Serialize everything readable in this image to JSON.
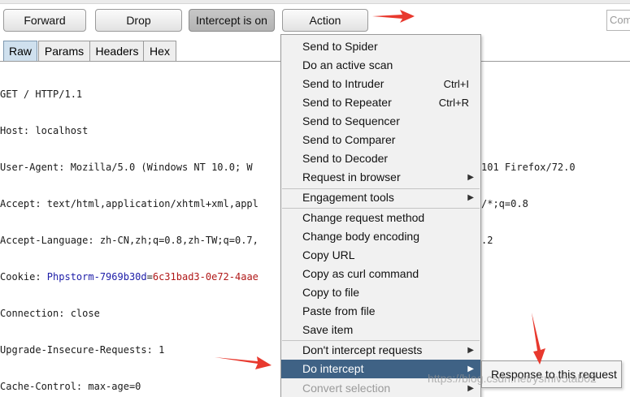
{
  "toolbar": {
    "forward_label": "Forward",
    "drop_label": "Drop",
    "intercept_label": "Intercept is on",
    "action_label": "Action",
    "search_placeholder": "Comment this item"
  },
  "tabs": [
    {
      "label": "Raw",
      "active": true
    },
    {
      "label": "Params",
      "active": false
    },
    {
      "label": "Headers",
      "active": false
    },
    {
      "label": "Hex",
      "active": false
    }
  ],
  "request": {
    "l1": "GET / HTTP/1.1",
    "l2": "Host: localhost",
    "l3a": "User-Agent: Mozilla/5.0 (Windows NT 10.0; W",
    "l3b": "101 Firefox/72.0",
    "l4a": "Accept: text/html,application/xhtml+xml,appl",
    "l4b": "/*;q=0.8",
    "l5a": "Accept-Language: zh-CN,zh;q=0.8,zh-TW;q=0.7,",
    "l5b": ".2",
    "l6_key": "Cookie: ",
    "l6_name": "Phpstorm-7969b30d",
    "l6_eq": "=",
    "l6_value": "6c31bad3-0e72-4aae",
    "l7": "Connection: close",
    "l8": "Upgrade-Insecure-Requests: 1",
    "l9": "Cache-Control: max-age=0"
  },
  "menu": {
    "items": [
      {
        "label": "Send to Spider"
      },
      {
        "label": "Do an active scan"
      },
      {
        "label": "Send to Intruder",
        "shortcut": "Ctrl+I"
      },
      {
        "label": "Send to Repeater",
        "shortcut": "Ctrl+R"
      },
      {
        "label": "Send to Sequencer"
      },
      {
        "label": "Send to Comparer"
      },
      {
        "label": "Send to Decoder"
      },
      {
        "label": "Request in browser",
        "arrow": "▶"
      },
      {
        "label": "Engagement tools",
        "arrow": "▶"
      },
      {
        "label": "Change request method"
      },
      {
        "label": "Change body encoding"
      },
      {
        "label": "Copy URL"
      },
      {
        "label": "Copy as curl command"
      },
      {
        "label": "Copy to file"
      },
      {
        "label": "Paste from file"
      },
      {
        "label": "Save item"
      },
      {
        "label": "Don't intercept requests",
        "arrow": "▶"
      },
      {
        "label": "Do intercept",
        "arrow": "▶",
        "highlighted": true
      },
      {
        "label": "Convert selection",
        "arrow": "▶",
        "disabled": true
      }
    ]
  },
  "submenu": {
    "item": "Response to this request"
  },
  "watermark": "https://blog.csdn.net/ysmiv5tab02",
  "colors": {
    "highlight": "#3f6285",
    "annotation_arrow": "#e8392e",
    "tab_active": "#cfe0ee",
    "cookie_name": "#1d1da8",
    "cookie_value": "#b01818"
  }
}
